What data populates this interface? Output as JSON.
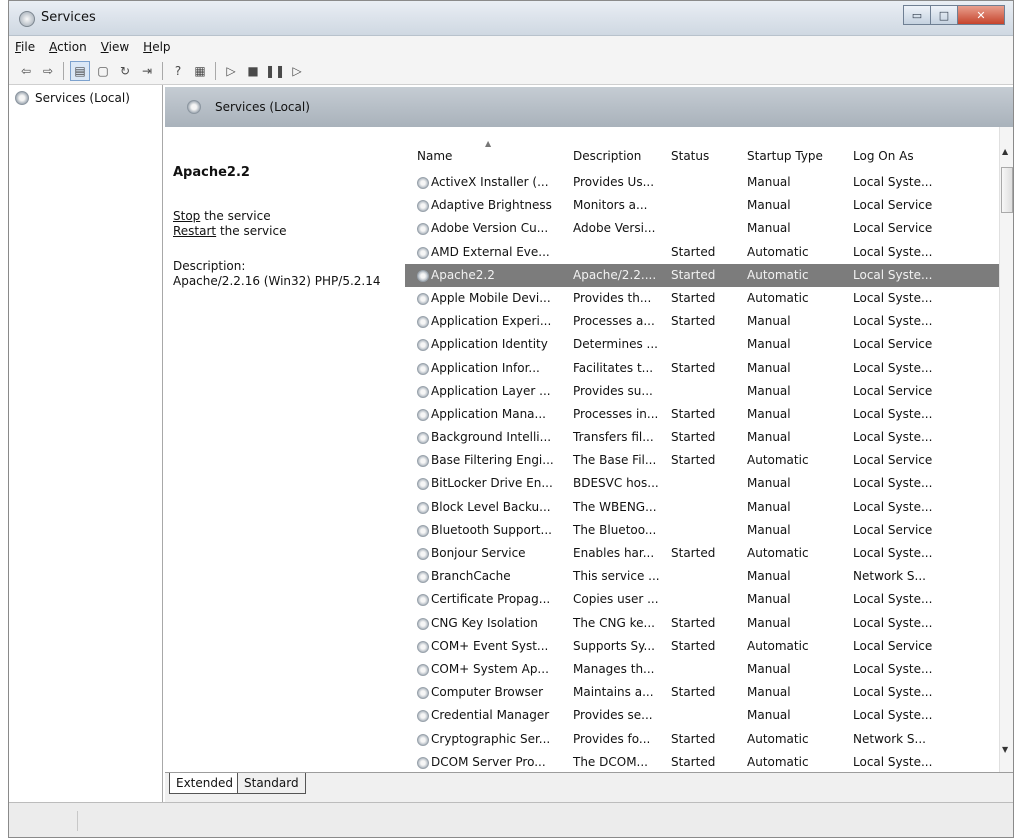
{
  "window": {
    "title": "Services"
  },
  "menu": [
    {
      "label": "File",
      "accel": "F",
      "rest": "ile"
    },
    {
      "label": "Action",
      "accel": "A",
      "rest": "ction"
    },
    {
      "label": "View",
      "accel": "V",
      "rest": "iew"
    },
    {
      "label": "Help",
      "accel": "H",
      "rest": "elp"
    }
  ],
  "toolbar_icons": [
    "back-arrow-icon",
    "forward-arrow-icon",
    "show-hide-tree-icon",
    "properties-icon",
    "refresh-icon",
    "export-list-icon",
    "help-icon",
    "show-action-pane-icon",
    "play-icon",
    "stop-icon",
    "pause-icon",
    "resume-icon"
  ],
  "tree": {
    "root_label": "Services (Local)"
  },
  "panel": {
    "header": "Services (Local)"
  },
  "detail": {
    "service_name": "Apache2.2",
    "stop_link_accel": "Stop",
    "stop_link_rest": " the service",
    "restart_link_accel": "Restart",
    "restart_link_rest": " the service",
    "description_label": "Description:",
    "description_text": "Apache/2.2.16 (Win32) PHP/5.2.14"
  },
  "columns": {
    "name": "Name",
    "description": "Description",
    "status": "Status",
    "startup": "Startup Type",
    "logon": "Log On As"
  },
  "rows": [
    {
      "name": "ActiveX Installer (...",
      "description": "Provides Us...",
      "status": "",
      "startup": "Manual",
      "logon": "Local Syste..."
    },
    {
      "name": "Adaptive Brightness",
      "description": "Monitors a...",
      "status": "",
      "startup": "Manual",
      "logon": "Local Service"
    },
    {
      "name": "Adobe Version Cu...",
      "description": "Adobe Versi...",
      "status": "",
      "startup": "Manual",
      "logon": "Local Service"
    },
    {
      "name": "AMD External Eve...",
      "description": "",
      "status": "Started",
      "startup": "Automatic",
      "logon": "Local Syste..."
    },
    {
      "name": "Apache2.2",
      "description": "Apache/2.2....",
      "status": "Started",
      "startup": "Automatic",
      "logon": "Local Syste...",
      "selected": true
    },
    {
      "name": "Apple Mobile Devi...",
      "description": "Provides th...",
      "status": "Started",
      "startup": "Automatic",
      "logon": "Local Syste..."
    },
    {
      "name": "Application Experi...",
      "description": "Processes a...",
      "status": "Started",
      "startup": "Manual",
      "logon": "Local Syste..."
    },
    {
      "name": "Application Identity",
      "description": "Determines ...",
      "status": "",
      "startup": "Manual",
      "logon": "Local Service"
    },
    {
      "name": "Application Infor...",
      "description": "Facilitates t...",
      "status": "Started",
      "startup": "Manual",
      "logon": "Local Syste..."
    },
    {
      "name": "Application Layer ...",
      "description": "Provides su...",
      "status": "",
      "startup": "Manual",
      "logon": "Local Service"
    },
    {
      "name": "Application Mana...",
      "description": "Processes in...",
      "status": "Started",
      "startup": "Manual",
      "logon": "Local Syste..."
    },
    {
      "name": "Background Intelli...",
      "description": "Transfers fil...",
      "status": "Started",
      "startup": "Manual",
      "logon": "Local Syste..."
    },
    {
      "name": "Base Filtering Engi...",
      "description": "The Base Fil...",
      "status": "Started",
      "startup": "Automatic",
      "logon": "Local Service"
    },
    {
      "name": "BitLocker Drive En...",
      "description": "BDESVC hos...",
      "status": "",
      "startup": "Manual",
      "logon": "Local Syste..."
    },
    {
      "name": "Block Level Backu...",
      "description": "The WBENG...",
      "status": "",
      "startup": "Manual",
      "logon": "Local Syste..."
    },
    {
      "name": "Bluetooth Support...",
      "description": "The Bluetoo...",
      "status": "",
      "startup": "Manual",
      "logon": "Local Service"
    },
    {
      "name": "Bonjour Service",
      "description": "Enables har...",
      "status": "Started",
      "startup": "Automatic",
      "logon": "Local Syste..."
    },
    {
      "name": "BranchCache",
      "description": "This service ...",
      "status": "",
      "startup": "Manual",
      "logon": "Network S..."
    },
    {
      "name": "Certificate Propag...",
      "description": "Copies user ...",
      "status": "",
      "startup": "Manual",
      "logon": "Local Syste..."
    },
    {
      "name": "CNG Key Isolation",
      "description": "The CNG ke...",
      "status": "Started",
      "startup": "Manual",
      "logon": "Local Syste..."
    },
    {
      "name": "COM+ Event Syst...",
      "description": "Supports Sy...",
      "status": "Started",
      "startup": "Automatic",
      "logon": "Local Service"
    },
    {
      "name": "COM+ System Ap...",
      "description": "Manages th...",
      "status": "",
      "startup": "Manual",
      "logon": "Local Syste..."
    },
    {
      "name": "Computer Browser",
      "description": "Maintains a...",
      "status": "Started",
      "startup": "Manual",
      "logon": "Local Syste..."
    },
    {
      "name": "Credential Manager",
      "description": "Provides se...",
      "status": "",
      "startup": "Manual",
      "logon": "Local Syste..."
    },
    {
      "name": "Cryptographic Ser...",
      "description": "Provides fo...",
      "status": "Started",
      "startup": "Automatic",
      "logon": "Network S..."
    },
    {
      "name": "DCOM Server Pro...",
      "description": "The DCOM...",
      "status": "Started",
      "startup": "Automatic",
      "logon": "Local Syste..."
    }
  ],
  "tabs": [
    "Extended",
    "Standard"
  ]
}
